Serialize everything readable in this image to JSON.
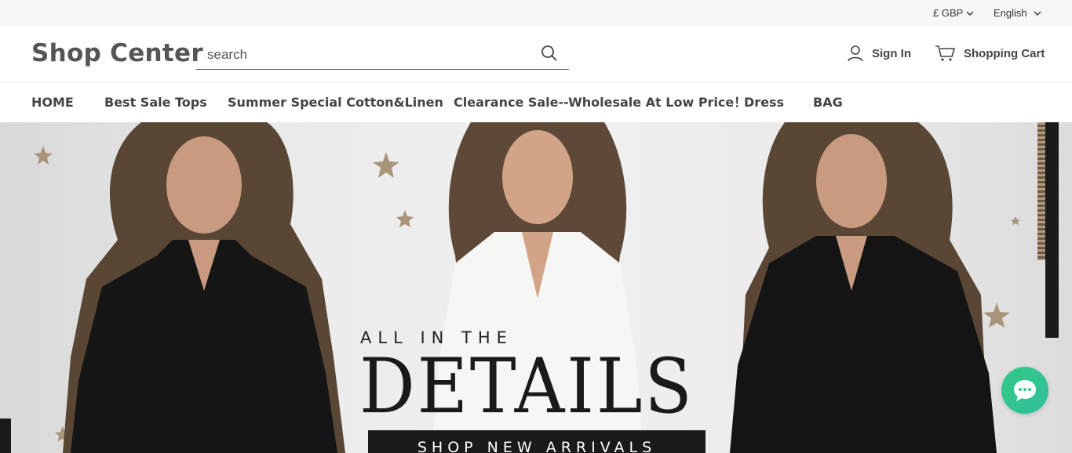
{
  "topbar": {
    "currency": "£ GBP",
    "language": "English"
  },
  "header": {
    "logo": "Shop Center",
    "search_placeholder": "search",
    "sign_in": "Sign In",
    "cart": "Shopping Cart"
  },
  "nav": {
    "items": [
      {
        "label": "HOME"
      },
      {
        "label": "Best Sale Tops"
      },
      {
        "label": "Summer Special Cotton&Linen"
      },
      {
        "label": "Clearance Sale--Wholesale At Low Price！"
      },
      {
        "label": "Dress"
      },
      {
        "label": "BAG"
      }
    ]
  },
  "hero": {
    "subtitle": "ALL IN THE",
    "title": "DETAILS",
    "cta": "SHOP NEW ARRIVALS"
  },
  "colors": {
    "accent_chat": "#34c987",
    "hero_button": "#1a1a1a"
  },
  "icons": {
    "search": "search-icon",
    "user": "user-icon",
    "cart": "cart-icon",
    "chat": "chat-icon",
    "chevron": "chevron-down-icon"
  }
}
